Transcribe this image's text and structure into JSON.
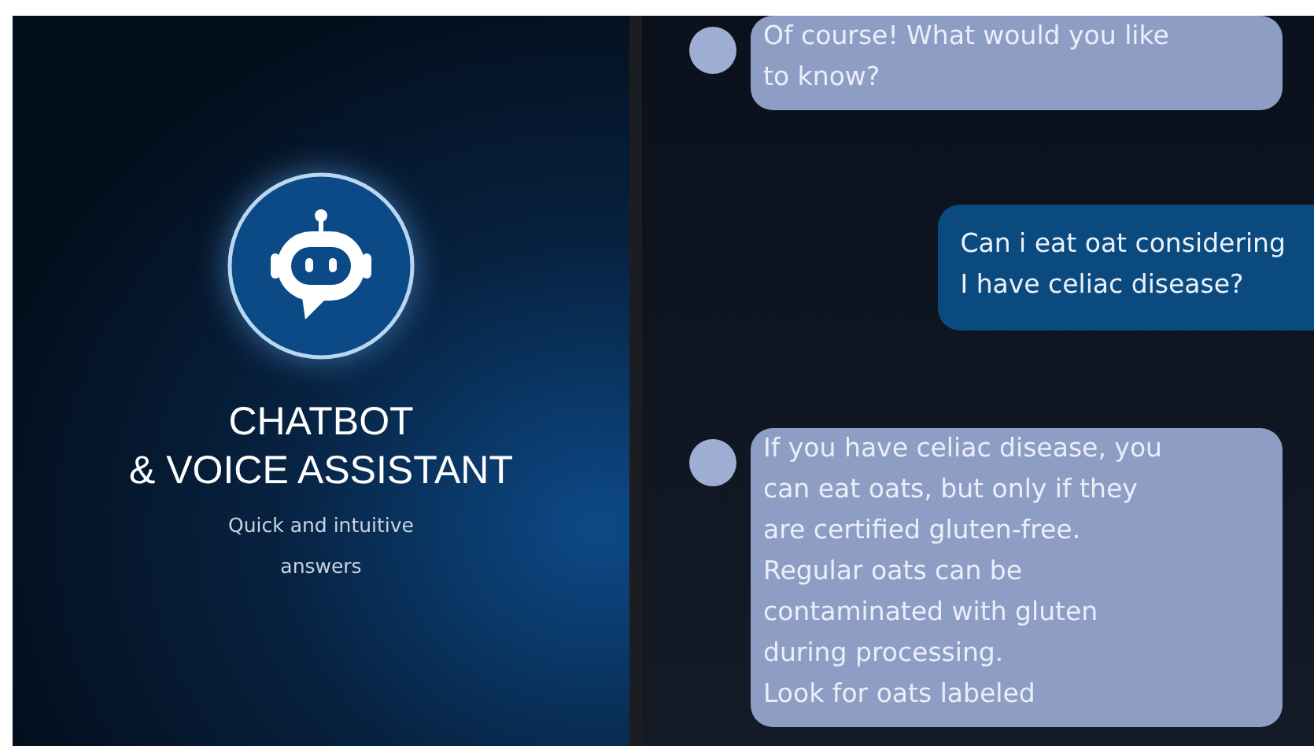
{
  "splash": {
    "title": "CHATBOT",
    "subtitle": "& VOICE ASSISTANT",
    "tagline": "Quick and intuitive\nanswers"
  },
  "messages": [
    {
      "kind": "bot",
      "text": "Of course! What would you like\nto know?"
    },
    {
      "kind": "user",
      "text": "Can i eat oat considering\nI have celiac disease?"
    },
    {
      "kind": "bot",
      "text": "If you have celiac disease, you\ncan eat oats, but only if they\nare certified gluten-free.\nRegular oats can be\ncontaminated with gluten\nduring processing.\nLook for oats labeled"
    }
  ]
}
